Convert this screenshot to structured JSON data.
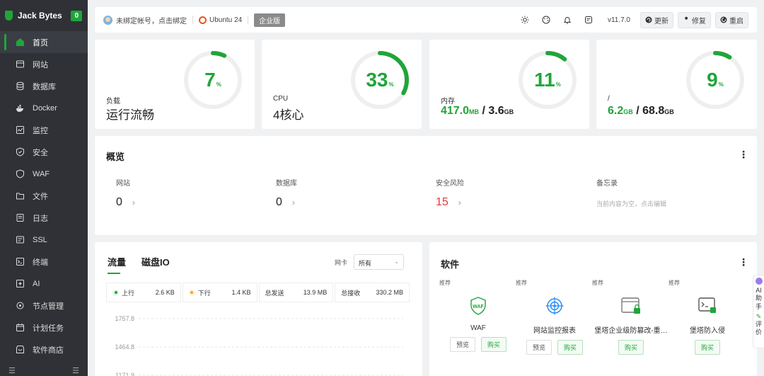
{
  "brand": {
    "name": "Jack Bytes",
    "badge": "0"
  },
  "sidebar": {
    "items": [
      {
        "label": "首页",
        "icon": "home-icon",
        "active": true
      },
      {
        "label": "网站",
        "icon": "globe-icon"
      },
      {
        "label": "数据库",
        "icon": "database-icon"
      },
      {
        "label": "Docker",
        "icon": "docker-icon"
      },
      {
        "label": "监控",
        "icon": "monitor-icon"
      },
      {
        "label": "安全",
        "icon": "shield-icon"
      },
      {
        "label": "WAF",
        "icon": "waf-icon"
      },
      {
        "label": "文件",
        "icon": "folder-icon"
      },
      {
        "label": "日志",
        "icon": "log-icon"
      },
      {
        "label": "SSL",
        "icon": "ssl-icon"
      },
      {
        "label": "终端",
        "icon": "terminal-icon"
      },
      {
        "label": "AI",
        "icon": "ai-icon"
      },
      {
        "label": "节点管理",
        "icon": "node-icon"
      },
      {
        "label": "计划任务",
        "icon": "calendar-icon"
      },
      {
        "label": "软件商店",
        "icon": "store-icon"
      }
    ]
  },
  "topbar": {
    "account": "未绑定帐号，点击绑定",
    "os": "Ubuntu 24",
    "edition": "企业版",
    "version": "v11.7.0",
    "update": "更新",
    "repair": "修复",
    "restart": "重启"
  },
  "gauges": [
    {
      "label": "负载",
      "percent": "7",
      "pct_sym": "%",
      "value": "运行流畅",
      "ratio": 0.07
    },
    {
      "label": "CPU",
      "percent": "33",
      "pct_sym": "%",
      "value": "4核心",
      "ratio": 0.33
    },
    {
      "label": "内存",
      "percent": "11",
      "pct_sym": "%",
      "used": "417.0",
      "used_unit": "MB",
      "slash": " / ",
      "total": "3.6",
      "total_unit": "GB",
      "ratio": 0.11
    },
    {
      "label": "/",
      "percent": "9",
      "pct_sym": "%",
      "used": "6.2",
      "used_unit": "GB",
      "slash": " / ",
      "total": "68.8",
      "total_unit": "GB",
      "ratio": 0.09
    }
  ],
  "overview": {
    "title": "概览",
    "items": [
      {
        "label": "网站",
        "value": "0"
      },
      {
        "label": "数据库",
        "value": "0"
      },
      {
        "label": "安全风险",
        "value": "15"
      },
      {
        "label": "备忘录",
        "memo": "当前内容为空，点击编辑"
      }
    ]
  },
  "traffic": {
    "tab_traffic": "流量",
    "tab_disk": "磁盘IO",
    "nic_label": "网卡",
    "nic_value": "所有",
    "stats": {
      "up_label": "上行",
      "up_value": "2.6 KB",
      "down_label": "下行",
      "down_value": "1.4 KB",
      "sent_label": "总发送",
      "sent_value": "13.9 MB",
      "recv_label": "总接收",
      "recv_value": "330.2 MB"
    },
    "chart_data": {
      "type": "line",
      "y_ticks": [
        "1757.8",
        "1464.8",
        "1171.9"
      ],
      "series": []
    }
  },
  "software": {
    "title": "软件",
    "items": [
      {
        "tag": "推荐",
        "name": "WAF",
        "preview": "预览",
        "buy": "购买",
        "icon": "waf-shield-icon"
      },
      {
        "tag": "推荐",
        "name": "网站监控报表",
        "preview": "预览",
        "buy": "购买",
        "icon": "target-icon"
      },
      {
        "tag": "推荐",
        "name": "堡塔企业级防篡改-重…",
        "buy": "购买",
        "icon": "tamper-lock-icon"
      },
      {
        "tag": "推荐",
        "name": "堡塔防入侵",
        "buy": "购买",
        "icon": "intrusion-terminal-icon"
      }
    ]
  },
  "ai_float": {
    "line1": "AI",
    "line2": "助",
    "line3": "手",
    "line4": "评",
    "line5": "价"
  },
  "colors": {
    "accent": "#20a53a",
    "danger": "#e53935",
    "sidebar": "#2f3136"
  }
}
